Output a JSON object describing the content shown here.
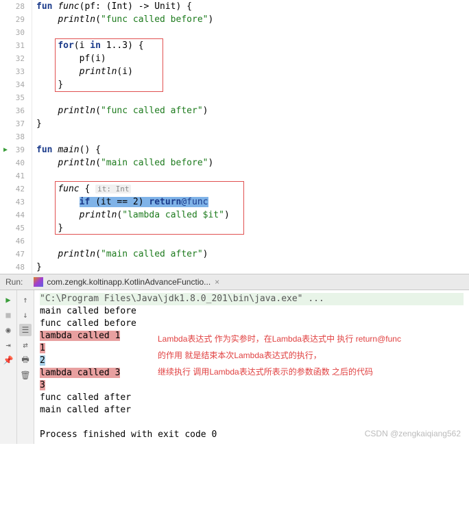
{
  "gutter": [
    "28",
    "29",
    "30",
    "31",
    "32",
    "33",
    "34",
    "35",
    "36",
    "37",
    "38",
    "39",
    "40",
    "41",
    "42",
    "43",
    "44",
    "45",
    "46",
    "47",
    "48"
  ],
  "code": {
    "l28_kw1": "fun",
    "l28_fn": "func",
    "l28_rest": "(pf: (Int) -> Unit) {",
    "l29_fn": "println",
    "l29_p1": "(",
    "l29_str": "\"func called before\"",
    "l29_p2": ")",
    "l31_kw": "for",
    "l31_rest1": "(i ",
    "l31_kw2": "in",
    "l31_rest2": " 1..3) {",
    "l32": "pf(i)",
    "l33_fn": "println",
    "l33_p1": "(i)",
    "l34": "}",
    "l36_fn": "println",
    "l36_p1": "(",
    "l36_str": "\"func called after\"",
    "l36_p2": ")",
    "l37": "}",
    "l39_kw": "fun",
    "l39_fn": "main",
    "l39_rest": "() {",
    "l40_fn": "println",
    "l40_p1": "(",
    "l40_str": "\"main called before\"",
    "l40_p2": ")",
    "l42_fn": "func ",
    "l42_br": "{",
    "l42_hint": "it: Int",
    "l43_kw1": "if ",
    "l43_cond": "(it == 2) ",
    "l43_kw2": "return",
    "l43_lbl": "@func",
    "l44_fn": "println",
    "l44_p1": "(",
    "l44_str": "\"lambda called $it\"",
    "l44_p2": ")",
    "l45": "}",
    "l47_fn": "println",
    "l47_p1": "(",
    "l47_str": "\"main called after\"",
    "l47_p2": ")",
    "l48": "}"
  },
  "run": {
    "label": "Run:",
    "tab": "com.zengk.koltinapp.KotlinAdvanceFunctio...",
    "close": "×"
  },
  "console": {
    "cmd": "\"C:\\Program Files\\Java\\jdk1.8.0_201\\bin\\java.exe\" ...",
    "l1": "main called before",
    "l2": "func called before",
    "l3": "lambda called 1",
    "l4": "1",
    "l5": "2",
    "l6": "lambda called 3",
    "l7": "3",
    "l8": "func called after",
    "l9": "main called after",
    "l10": "Process finished with exit code 0"
  },
  "annot": {
    "a1": "Lambda表达式 作为实参时，在Lambda表达式中 执行 return@func",
    "a2": "的作用 就是结束本次Lambda表达式的执行，",
    "a3": "继续执行 调用Lambda表达式所表示的参数函数 之后的代码"
  },
  "watermark": "CSDN @zengkaiqiang562"
}
